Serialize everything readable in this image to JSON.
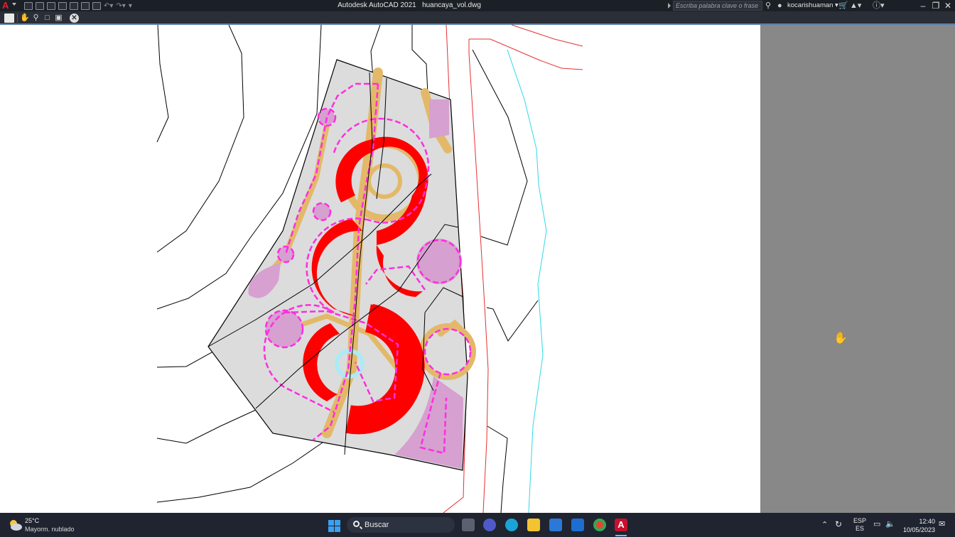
{
  "titlebar": {
    "app_name": "Autodesk AutoCAD 2021",
    "file_name": "huancaya_vol.dwg",
    "search_placeholder": "Escriba palabra clave o frase",
    "user_name": "kocarishuaman"
  },
  "taskbar": {
    "weather_temp": "25°C",
    "weather_desc": "Mayorm. nublado",
    "search_label": "Buscar",
    "lang_top": "ESP",
    "lang_bottom": "ES",
    "time": "12:40",
    "date": "10/05/2023"
  },
  "colors": {
    "title_bg": "#1b1f26",
    "toolbar_bg": "#2a2e36",
    "canvas_gray": "#888888",
    "paper": "#ffffff",
    "red_fill": "#ff0000",
    "magenta": "#ff2de0",
    "pink_fill": "#d6a0d0",
    "tan": "#e3b969",
    "site_gray": "#dcdcdc",
    "taskbar_bg": "#1f2430"
  },
  "icons": {
    "toolbar": [
      "print-icon",
      "pan-icon",
      "zoom-icon",
      "zoom-window-icon",
      "zoom-extents-icon",
      "close-preview-icon"
    ],
    "taskbar": [
      "start-icon",
      "search-icon",
      "task-view-icon",
      "teams-icon",
      "edge-icon",
      "file-explorer-icon",
      "store-icon",
      "mail-icon",
      "chrome-icon",
      "autocad-icon"
    ]
  }
}
